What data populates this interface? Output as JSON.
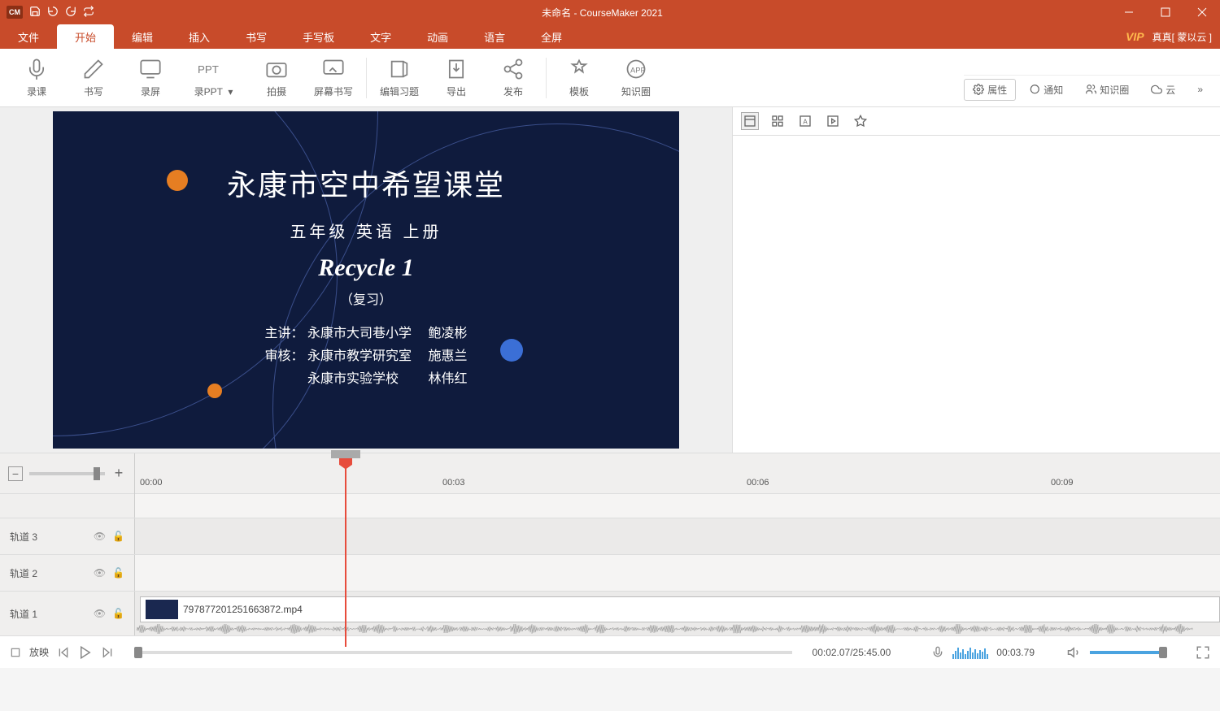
{
  "title": "未命名 - CourseMaker 2021",
  "vip": "VIP",
  "user": "真真[ 蒙以云 ]",
  "menu": [
    "文件",
    "开始",
    "编辑",
    "插入",
    "书写",
    "手写板",
    "文字",
    "动画",
    "语言",
    "全屏"
  ],
  "menuActiveIndex": 1,
  "tools": {
    "record": "录课",
    "write": "书写",
    "screen": "录屏",
    "ppt": "录PPT",
    "photo": "拍摄",
    "screenwrite": "屏幕书写",
    "exercise": "编辑习题",
    "export": "导出",
    "publish": "发布",
    "template": "模板",
    "knowledge": "知识圈"
  },
  "rightTabs": {
    "props": "属性",
    "notify": "通知",
    "circle": "知识圈",
    "cloud": "云"
  },
  "slide": {
    "h1": "永康市空中希望课堂",
    "sub": "五年级 英语 上册",
    "title2": "Recycle 1",
    "note": "（复习）",
    "credit1": "主讲： 永康市大司巷小学　 鲍凌彬",
    "credit2": "审核： 永康市教学研究室　 施惠兰",
    "credit3": "　　　 永康市实验学校　　 林伟红"
  },
  "ruler": {
    "t0": "00:00",
    "t1": "00:03",
    "t2": "00:06",
    "t3": "00:09"
  },
  "tracks": {
    "t3": "轨道 3",
    "t2": "轨道 2",
    "t1": "轨道 1"
  },
  "clip": "797877201251663872.mp4",
  "playbar": {
    "play": "放映",
    "time": "00:02.07/25:45.00",
    "level": "00:03.79"
  }
}
